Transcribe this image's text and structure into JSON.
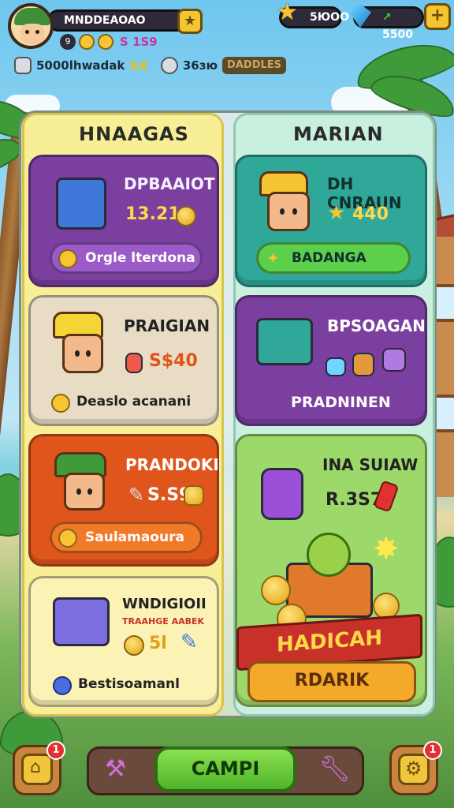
{
  "hud": {
    "player_name": "MNDDEAOAO",
    "sub_num": "9",
    "sub_value": "S 1S9",
    "currency_stars": "5ЮOO",
    "currency_gems": "5500"
  },
  "info_row": {
    "left_text": "5000lhwadak",
    "left_bolt": "5X",
    "right_text": "36зю",
    "right_badge": "DADDLES"
  },
  "columns": {
    "left_title": "HNAAGAS",
    "right_title": "MARIAN"
  },
  "cards": [
    {
      "title": "DPBAAIOT",
      "value": "13.210",
      "pill": "Orgle lterdona"
    },
    {
      "title": "PRAIGIAN",
      "value": "S$40",
      "pill": "Deaslo acanani"
    },
    {
      "title": "PRANDOKI",
      "value": "S.S9",
      "pill": "Saulamaoura"
    },
    {
      "title": "WNDIGIOII",
      "subtitle": "TRAAHGE AABEK",
      "value": "5l",
      "pill": "Bestisoamanl"
    },
    {
      "title": "DH CNRAUN",
      "value": "440",
      "pill": "BADANGA"
    },
    {
      "title": "BPSOAGAN",
      "footer": "PRADNINEN"
    },
    {
      "title": "INA SUIAW",
      "value": "R.3S7"
    }
  ],
  "reward": {
    "banner_top": "HADICAH",
    "banner_bottom": "RDARIK"
  },
  "bottom": {
    "main_button": "CAMPI",
    "home_badge": "1",
    "settings_badge": "1"
  },
  "colors": {
    "accent_green": "#4fb42a",
    "card_purple": "#7b3fa0",
    "card_teal": "#2fa89a",
    "card_orange": "#e0551c",
    "card_beige": "#e8dcc5",
    "card_light_yellow": "#fbf3b5",
    "card_lime": "#9dd86a"
  }
}
